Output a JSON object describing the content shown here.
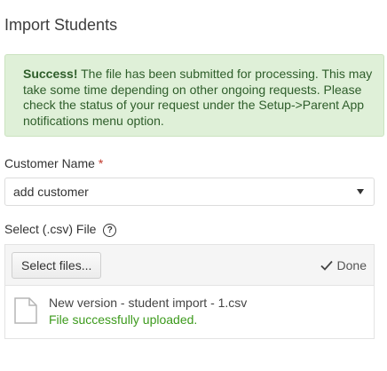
{
  "page": {
    "title": "Import Students"
  },
  "alert": {
    "strong": "Success!",
    "message": " The file has been submitted for processing. This may take some time depending on other ongoing requests. Please check the status of your request under the Setup->Parent App notifications menu option."
  },
  "customer": {
    "label": "Customer Name",
    "required_mark": "*",
    "selected": "add customer"
  },
  "file_select": {
    "label": "Select (.csv) File",
    "help": "?",
    "button": "Select files...",
    "done": "Done"
  },
  "uploaded_file": {
    "name": "New version - student import - 1.csv",
    "status": "File successfully uploaded.",
    "status_color": "#3c9a1c"
  },
  "colors": {
    "alert_bg": "#dff0d8",
    "alert_text": "#2e5d2a",
    "required": "#c0392b"
  }
}
